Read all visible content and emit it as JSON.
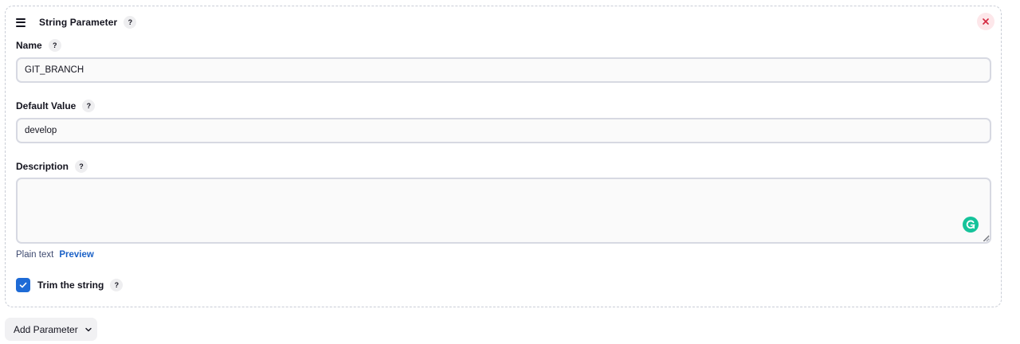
{
  "card": {
    "title": "String Parameter",
    "help_label": "?"
  },
  "fields": {
    "name": {
      "label": "Name",
      "value": "GIT_BRANCH"
    },
    "default_value": {
      "label": "Default Value",
      "value": "develop"
    },
    "description": {
      "label": "Description",
      "value": ""
    }
  },
  "format": {
    "plain_label": "Plain text",
    "preview_label": "Preview"
  },
  "trim": {
    "label": "Trim the string",
    "checked": true
  },
  "add_parameter": {
    "label": "Add Parameter"
  },
  "colors": {
    "accent": "#1e6bd6",
    "link": "#1c62c7",
    "remove_bg": "#fde7ea",
    "remove_icon": "#d3263e",
    "grammarly": "#15c39a"
  },
  "icons": {
    "drag": "drag-handle-icon",
    "remove": "close-icon",
    "help": "help-icon",
    "checkbox": "checkmark-icon",
    "dropdown": "chevron-down-icon",
    "grammarly": "grammarly-icon"
  }
}
